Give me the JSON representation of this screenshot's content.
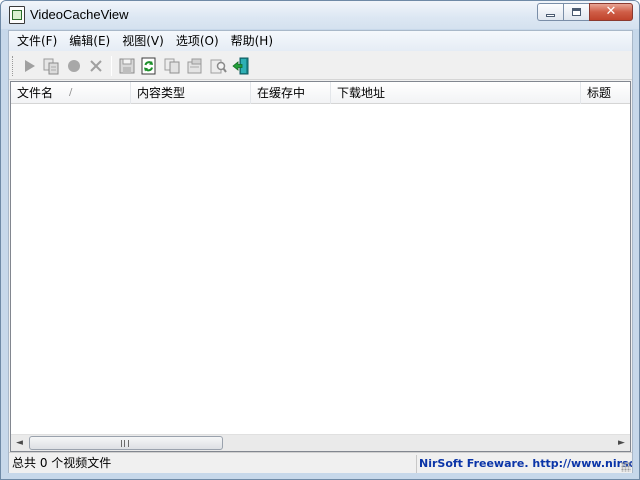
{
  "window": {
    "title": "VideoCacheView"
  },
  "caption": {
    "close_glyph": "✕"
  },
  "menu": {
    "items": [
      {
        "label": "文件(F)"
      },
      {
        "label": "编辑(E)"
      },
      {
        "label": "视图(V)"
      },
      {
        "label": "选项(O)"
      },
      {
        "label": "帮助(H)"
      }
    ]
  },
  "toolbar": {
    "icons": [
      "play-icon",
      "copy-files-icon",
      "stop-icon",
      "delete-icon",
      "save-icon",
      "refresh-icon",
      "copy-icon",
      "properties-icon",
      "find-icon",
      "exit-icon"
    ]
  },
  "list": {
    "columns": [
      {
        "label": "文件名"
      },
      {
        "label": "内容类型"
      },
      {
        "label": "在缓存中"
      },
      {
        "label": "下载地址"
      },
      {
        "label": "标题"
      }
    ],
    "sort_indicator": "/",
    "rows": []
  },
  "scrollbar": {
    "left_arrow": "◄",
    "right_arrow": "►"
  },
  "status": {
    "left_text": "总共 0 个视频文件",
    "right_text": "NirSoft Freeware.  http://www.nirsoft.net"
  },
  "colors": {
    "link_blue": "#0b35a8",
    "close_red": "#c0432c",
    "titlebar": "#dce7f3"
  }
}
